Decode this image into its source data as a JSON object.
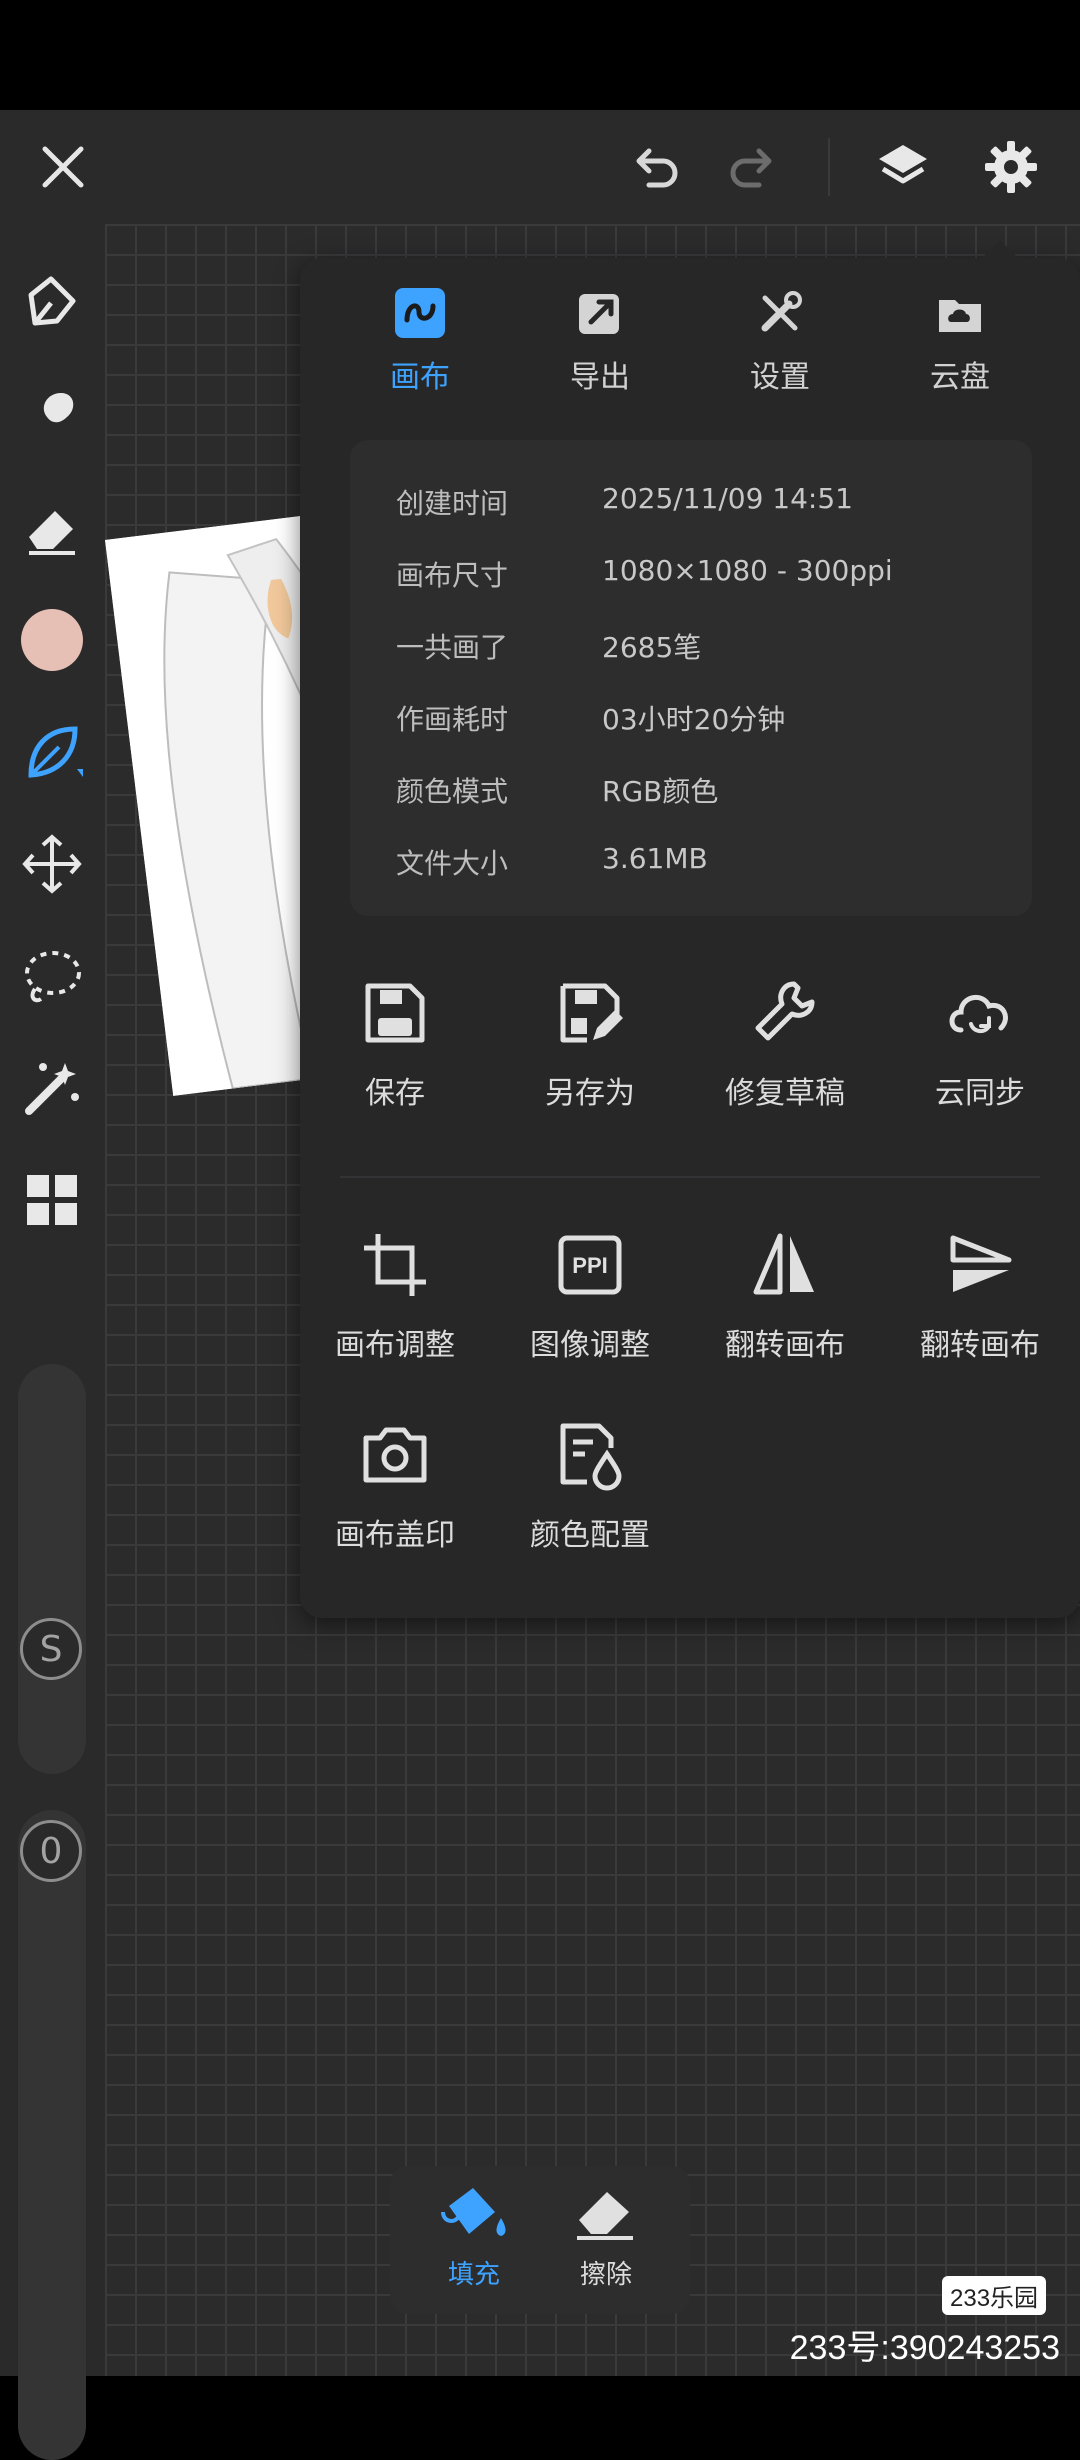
{
  "app": {
    "accent": "#3ea2ff",
    "brush_color": "#e7c0b5"
  },
  "topbar": {
    "icons": [
      "close-icon",
      "undo-icon",
      "redo-icon",
      "layers-icon",
      "settings-gear-icon"
    ]
  },
  "left_tools": [
    "brush-icon",
    "smudge-icon",
    "eraser-icon",
    "color-swatch",
    "leaf-brush-icon",
    "move-icon",
    "lasso-icon",
    "magic-wand-icon",
    "grid-menu-icon"
  ],
  "sliders": {
    "size_label": "S",
    "opacity_label": "0"
  },
  "panel": {
    "tabs": [
      {
        "label": "画布",
        "icon": "canvas-icon",
        "active": true
      },
      {
        "label": "导出",
        "icon": "export-icon",
        "active": false
      },
      {
        "label": "设置",
        "icon": "tools-icon",
        "active": false
      },
      {
        "label": "云盘",
        "icon": "cloud-folder-icon",
        "active": false
      }
    ],
    "info": [
      {
        "key": "创建时间",
        "value": "2025/11/09 14:51"
      },
      {
        "key": "画布尺寸",
        "value": "1080×1080 - 300ppi"
      },
      {
        "key": "一共画了",
        "value": "2685笔"
      },
      {
        "key": "作画耗时",
        "value": "03小时20分钟"
      },
      {
        "key": "颜色模式",
        "value": "RGB颜色"
      },
      {
        "key": "文件大小",
        "value": "3.61MB"
      }
    ],
    "actions_row1": [
      {
        "label": "保存",
        "icon": "save-icon"
      },
      {
        "label": "另存为",
        "icon": "save-as-icon"
      },
      {
        "label": "修复草稿",
        "icon": "wrench-icon"
      },
      {
        "label": "云同步",
        "icon": "cloud-sync-icon"
      }
    ],
    "actions_row2": [
      {
        "label": "画布调整",
        "icon": "crop-icon"
      },
      {
        "label": "图像调整",
        "icon": "ppi-icon",
        "badge": "PPI"
      },
      {
        "label": "翻转画布",
        "icon": "flip-horizontal-icon"
      },
      {
        "label": "翻转画布",
        "icon": "flip-vertical-icon"
      }
    ],
    "actions_row3": [
      {
        "label": "画布盖印",
        "icon": "camera-icon"
      },
      {
        "label": "颜色配置",
        "icon": "color-profile-icon"
      }
    ]
  },
  "bottom_tools": [
    {
      "label": "填充",
      "icon": "fill-bucket-icon",
      "active": true
    },
    {
      "label": "擦除",
      "icon": "eraser-icon",
      "active": false
    }
  ],
  "watermark": {
    "logo_text": "233乐园",
    "id_text": "233号:390243253"
  }
}
